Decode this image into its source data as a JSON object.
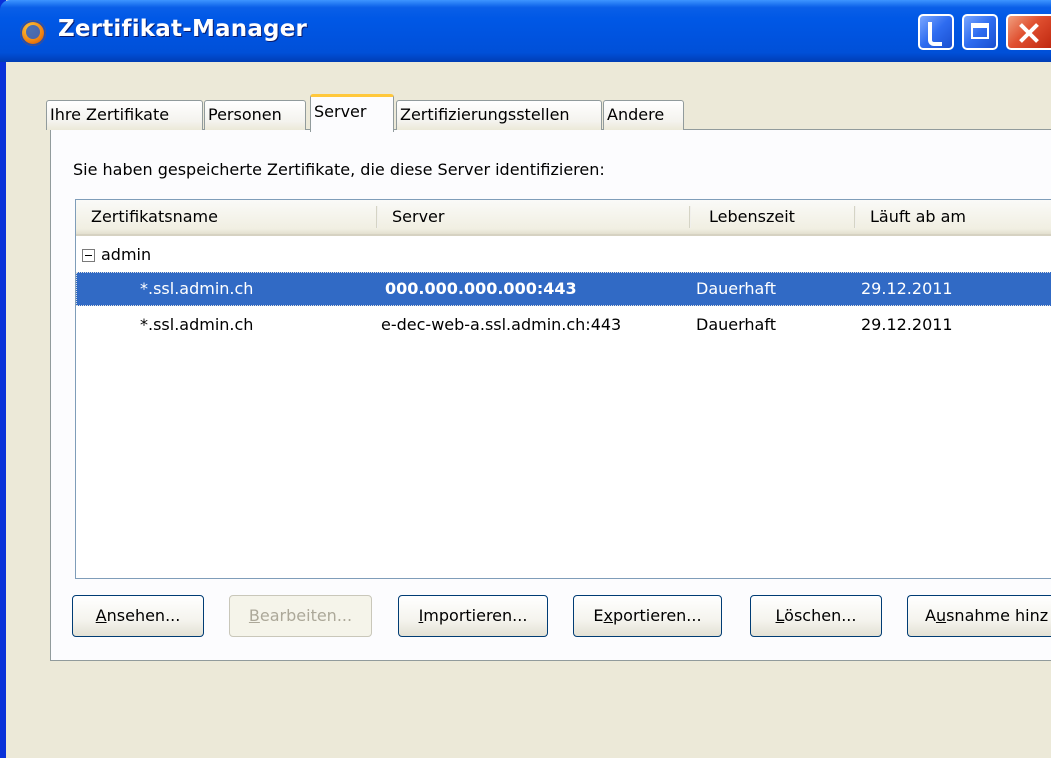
{
  "window": {
    "title": "Zertifikat-Manager"
  },
  "tabs": [
    {
      "label": "Ihre Zertifikate",
      "active": false
    },
    {
      "label": "Personen",
      "active": false
    },
    {
      "label": "Server",
      "active": true
    },
    {
      "label": "Zertifizierungsstellen",
      "active": false
    },
    {
      "label": "Andere",
      "active": false
    }
  ],
  "panel": {
    "prompt": "Sie haben gespeicherte Zertifikate, die diese Server identifizieren:"
  },
  "tree": {
    "columns": [
      "Zertifikatsname",
      "Server",
      "Lebenszeit",
      "Läuft ab am"
    ],
    "group": {
      "label": "admin",
      "expanded": true
    },
    "rows": [
      {
        "name": "*.ssl.admin.ch",
        "server": "000.000.000.000:443",
        "lifetime": "Dauerhaft",
        "expires": "29.12.2011",
        "selected": true
      },
      {
        "name": "*.ssl.admin.ch",
        "server": "e-dec-web-a.ssl.admin.ch:443",
        "lifetime": "Dauerhaft",
        "expires": "29.12.2011",
        "selected": false
      }
    ]
  },
  "buttons": {
    "view": {
      "accel": "A",
      "rest": "nsehen..."
    },
    "edit": {
      "accel": "B",
      "rest": "earbeiten...",
      "disabled": true
    },
    "import": {
      "accel": "I",
      "rest": "mportieren..."
    },
    "export": {
      "pre": "E",
      "accel": "x",
      "rest": "portieren..."
    },
    "delete": {
      "accel": "L",
      "rest": "öschen..."
    },
    "exception": {
      "pre": "A",
      "accel": "u",
      "rest": "snahme hinz"
    }
  },
  "colors": {
    "selection": "#316AC5",
    "titlebar": "#0053DF",
    "dialog": "#ECE9D8"
  }
}
